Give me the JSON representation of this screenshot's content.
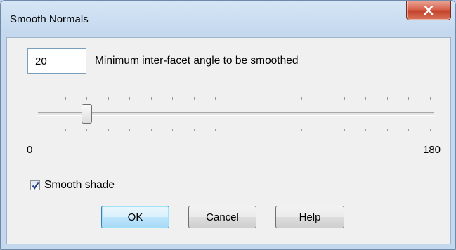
{
  "window": {
    "title": "Smooth Normals",
    "close_icon": "close-icon"
  },
  "angle_input": {
    "value": "20",
    "label": "Minimum inter-facet angle to be smoothed"
  },
  "slider": {
    "min": 0,
    "max": 180,
    "value": 20,
    "min_label": "0",
    "max_label": "180",
    "tick_count": 19
  },
  "smooth_shade": {
    "label": "Smooth shade",
    "checked": true
  },
  "buttons": {
    "ok": "OK",
    "cancel": "Cancel",
    "help": "Help"
  },
  "colors": {
    "title_bar": "#c4d8ee",
    "close_button": "#c4422b",
    "dialog_body": "#f0f0f0",
    "default_button": "#bee6fd"
  }
}
